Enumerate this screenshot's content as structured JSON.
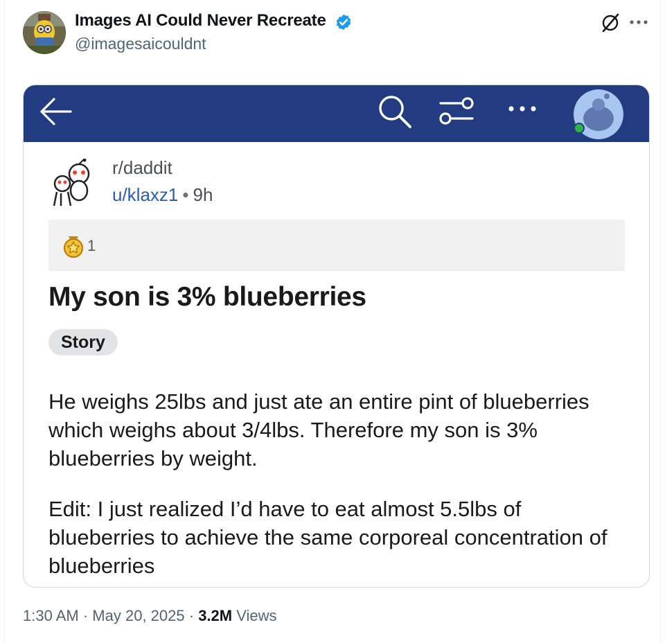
{
  "tweet": {
    "display_name": "Images AI Could Never Recreate",
    "handle": "@imagesaicouldnt",
    "time": "1:30 AM",
    "date": "May 20, 2025",
    "views_count": "3.2M",
    "views_label": "Views",
    "dot": "·"
  },
  "icons": {
    "verified": "verified-badge-icon",
    "grok": "grok-icon",
    "more": "more-options-icon",
    "back": "back-arrow-icon",
    "search": "search-icon",
    "filter": "filter-icon",
    "dots": "more-dots-icon",
    "award": "award-icon"
  },
  "reddit_post": {
    "subreddit": "r/daddit",
    "username": "u/klaxz1",
    "separator": "•",
    "age": "9h",
    "award_count": "1",
    "title": "My son is 3% blueberries",
    "flair": "Story",
    "body": [
      "He weighs 25lbs and just ate an entire pint of blueberries which weighs about 3/4lbs. Therefore my son is 3% blueberries by weight.",
      "Edit: I just realized I’d have to eat almost 5.5lbs of blueberries to achieve the same corporeal concentration of blueberries"
    ]
  },
  "colors": {
    "app_bar": "#233b80",
    "verified_blue": "#1d9bf0",
    "link_blue": "#2a5db0",
    "online_green": "#2eb34a"
  }
}
